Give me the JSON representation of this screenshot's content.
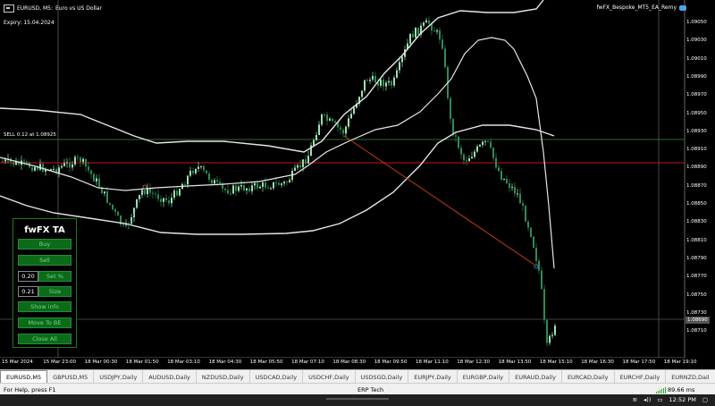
{
  "chart": {
    "symbol": "EURUSD, M5:",
    "description": "Euro vs US Dollar",
    "expiry": "Expiry: 15.04.2024",
    "ea_name": "fwFX_Bespoke_MT5_EA_Remy",
    "sell_label": "SELL 0.12 at 1.08925",
    "current_price": "1.08690",
    "price_ticks": [
      "1.09050",
      "1.09030",
      "1.09010",
      "1.08990",
      "1.08970",
      "1.08950",
      "1.08930",
      "1.08910",
      "1.08890",
      "1.08870",
      "1.08850",
      "1.08830",
      "1.08810",
      "1.08790",
      "1.08770",
      "1.08750",
      "1.08730",
      "1.08710"
    ],
    "time_ticks": [
      "15 Mar 2024",
      "15 Mar 23:00",
      "18 Mar 00:30",
      "18 Mar 01:50",
      "18 Mar 03:10",
      "18 Mar 04:30",
      "18 Mar 05:50",
      "18 Mar 07:10",
      "18 Mar 08:30",
      "18 Mar 09:50",
      "18 Mar 11:10",
      "18 Mar 12:30",
      "18 Mar 13:50",
      "18 Mar 15:10",
      "18 Mar 16:30",
      "18 Mar 17:50",
      "18 Mar 19:10"
    ],
    "colors": {
      "up": "#9fe0b0",
      "down": "#2e8b57",
      "band": "#e6e6e6",
      "hline_red": "#c81414",
      "hline_green": "#2f6a2f",
      "trend": "#c83c14"
    }
  },
  "panel": {
    "title": "fwFX TA",
    "buy": "Buy",
    "sell": "Sell",
    "lot_value": "0.20",
    "lot_label": "Set %",
    "size_value": "0.21",
    "size_label": "Size",
    "show_info": "Show info",
    "move_be": "Move To BE",
    "close_all": "Close All"
  },
  "tabs": [
    "EURUSD,M5",
    "GBPUSD,M5",
    "USDJPY,Daily",
    "AUDUSD,Daily",
    "NZDUSD,Daily",
    "USDCAD,Daily",
    "USDCHF,Daily",
    "USDSGD,Daily",
    "EURJPY,Daily",
    "EURGBP,Daily",
    "EURAUD,Daily",
    "EURCAD,Daily",
    "EURCHF,Daily",
    "EURNZD,Dail"
  ],
  "status": {
    "help": "For Help, press F1",
    "profile": "ERP Tech",
    "traffic": "89.66 ms"
  },
  "taskbar": {
    "time": "12:52 PM"
  }
}
